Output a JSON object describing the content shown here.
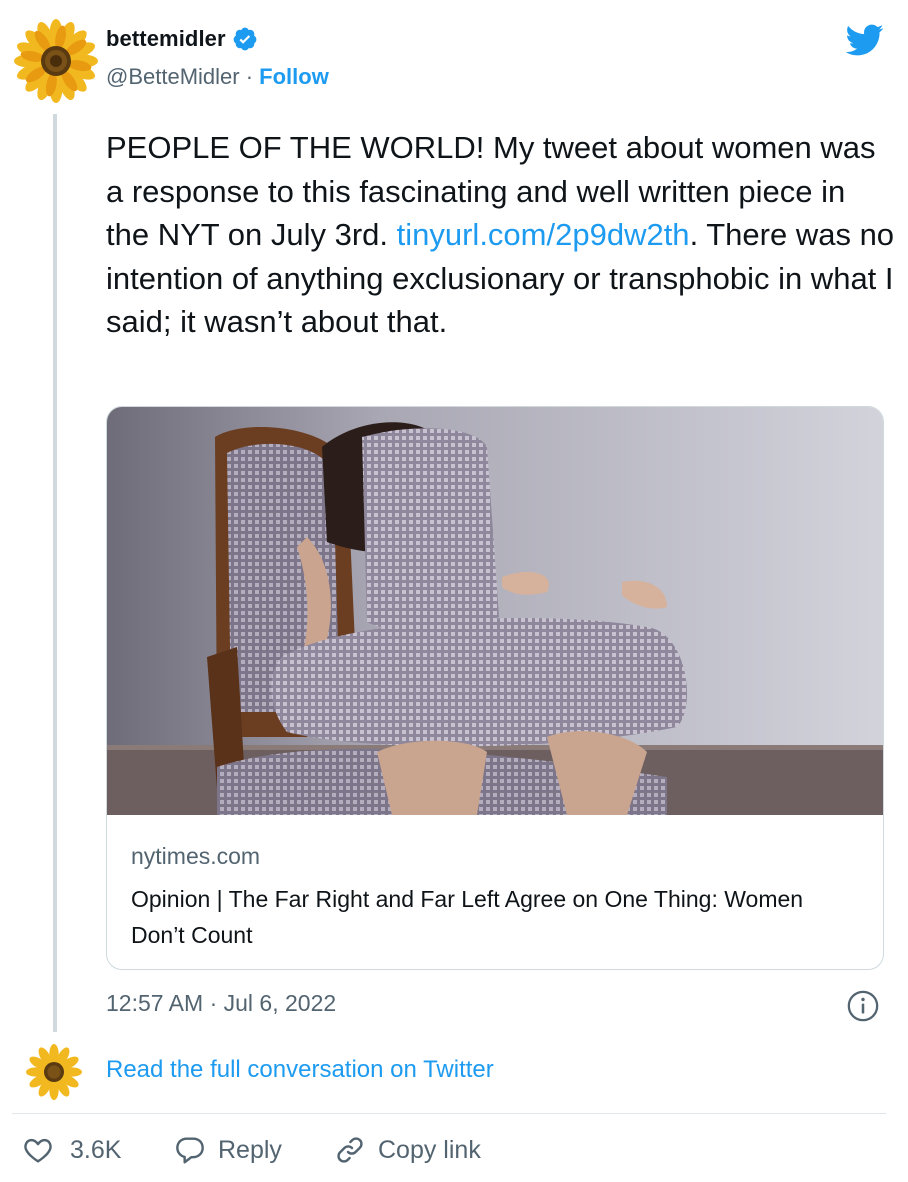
{
  "tweet": {
    "display_name": "bettemidler",
    "handle": "@BetteMidler",
    "separator": " · ",
    "follow_label": "Follow",
    "text_before_link": "PEOPLE OF THE WORLD! My tweet about women was a response to this fascinating and well written piece in the NYT on July 3rd. ",
    "link_text": "tinyurl.com/2p9dw2th",
    "text_after_link": ". There was no intention of anything exclusionary or transphobic in what I said;  it wasn’t about that.",
    "timestamp": "12:57 AM · Jul 6, 2022"
  },
  "card": {
    "domain": "nytimes.com",
    "title": "Opinion | The Far Right and Far Left Agree on One Thing: Women Don’t Count"
  },
  "footer": {
    "read_full_label": "Read the full conversation on Twitter",
    "like_count": "3.6K",
    "reply_label": "Reply",
    "copy_link_label": "Copy link"
  },
  "icons": {
    "verified": "verified-badge-icon",
    "brand": "twitter-bird-icon",
    "info": "info-icon",
    "like": "heart-icon",
    "reply": "speech-bubble-icon",
    "copy_link": "link-icon"
  },
  "colors": {
    "accent": "#1d9bf0",
    "text": "#0f1419",
    "secondary": "#536471",
    "border": "#cfd9de"
  }
}
